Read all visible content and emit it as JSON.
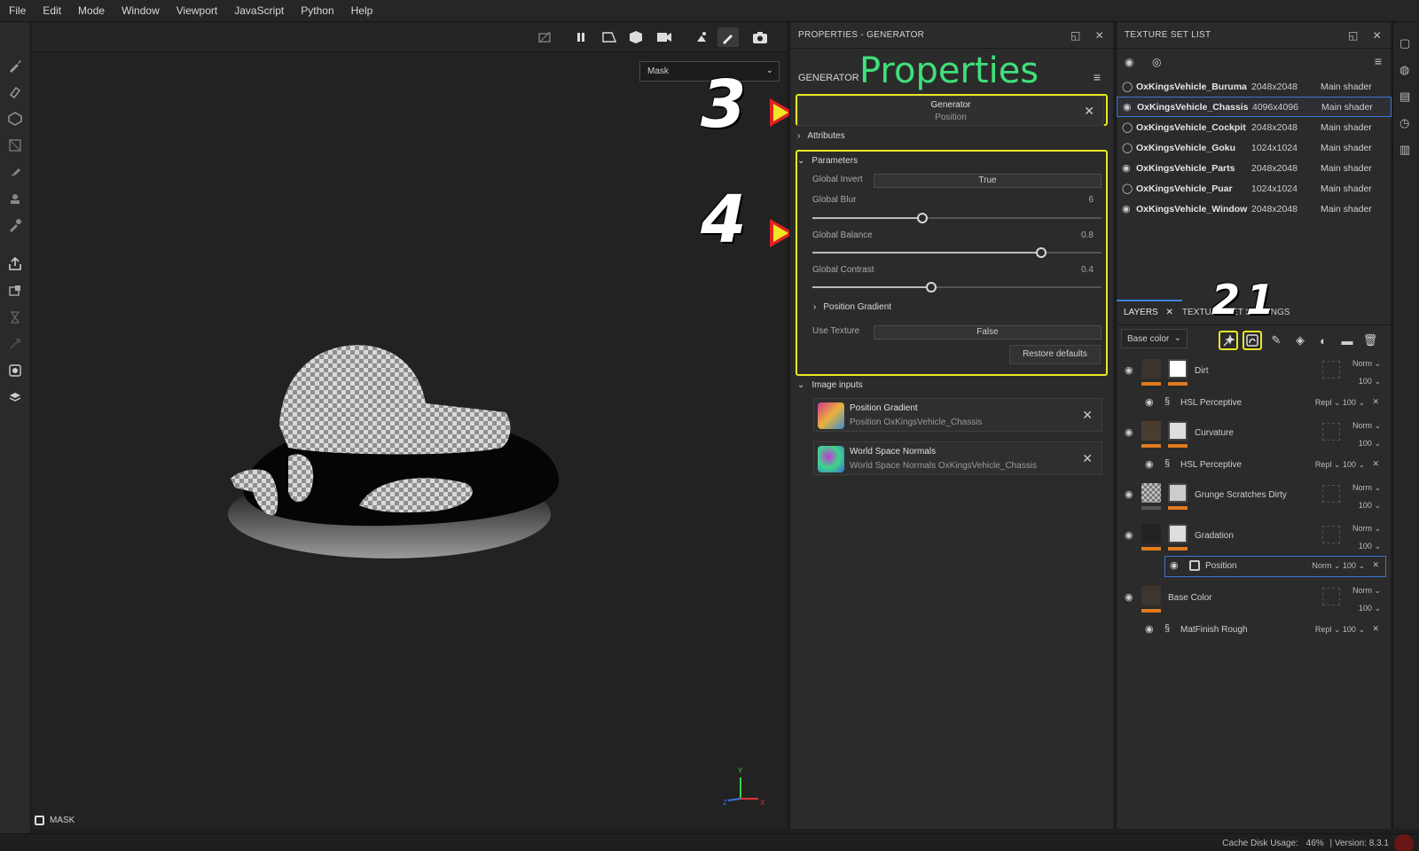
{
  "menu": [
    "File",
    "Edit",
    "Mode",
    "Window",
    "Viewport",
    "JavaScript",
    "Python",
    "Help"
  ],
  "viewport": {
    "mask_select": "Mask",
    "mask_label": "MASK",
    "axis_labels": {
      "y": "Y",
      "z": "Z",
      "x": "X"
    }
  },
  "properties": {
    "header": "PROPERTIES - GENERATOR",
    "section_title": "GENERATOR",
    "overlay_title": "Properties",
    "generator_card": {
      "title": "Generator",
      "subtitle": "Position"
    },
    "attributes_label": "Attributes",
    "parameters_label": "Parameters",
    "params": {
      "global_invert_label": "Global Invert",
      "global_invert_value": "True",
      "global_blur_label": "Global Blur",
      "global_blur_value": "6",
      "global_balance_label": "Global Balance",
      "global_balance_value": "0.8",
      "global_contrast_label": "Global Contrast",
      "global_contrast_value": "0.4",
      "position_gradient_label": "Position Gradient",
      "use_texture_label": "Use Texture",
      "use_texture_value": "False"
    },
    "slider_fractions": {
      "blur": 0.38,
      "balance": 0.79,
      "contrast": 0.41
    },
    "restore_label": "Restore defaults",
    "image_inputs_label": "Image inputs",
    "image_inputs": [
      {
        "name": "Position Gradient",
        "source": "Position OxKingsVehicle_Chassis"
      },
      {
        "name": "World Space Normals",
        "source": "World Space Normals OxKingsVehicle_Chassis"
      }
    ]
  },
  "annotations": {
    "num3": "3",
    "num4": "4",
    "num2": "2",
    "num1": "1"
  },
  "texture_set_list": {
    "header": "TEXTURE SET LIST",
    "rows": [
      {
        "name": "OxKingsVehicle_Buruma",
        "res": "2048x2048",
        "shader": "Main shader"
      },
      {
        "name": "OxKingsVehicle_Chassis",
        "res": "4096x4096",
        "shader": "Main shader"
      },
      {
        "name": "OxKingsVehicle_Cockpit",
        "res": "2048x2048",
        "shader": "Main shader"
      },
      {
        "name": "OxKingsVehicle_Goku",
        "res": "1024x1024",
        "shader": "Main shader"
      },
      {
        "name": "OxKingsVehicle_Parts",
        "res": "2048x2048",
        "shader": "Main shader"
      },
      {
        "name": "OxKingsVehicle_Puar",
        "res": "1024x1024",
        "shader": "Main shader"
      },
      {
        "name": "OxKingsVehicle_Window",
        "res": "2048x2048",
        "shader": "Main shader"
      }
    ]
  },
  "layers": {
    "tab_layers": "LAYERS",
    "tab_tss": "TEXTURE SET SETTINGS",
    "channel": "Base color",
    "items": [
      {
        "name": "Dirt",
        "blend": "Norm",
        "opacity": "100"
      },
      {
        "name": "HSL Perceptive",
        "blend": "Repl",
        "opacity": "100"
      },
      {
        "name": "Curvature",
        "blend": "Norm",
        "opacity": "100"
      },
      {
        "name": "HSL Perceptive",
        "blend": "Repl",
        "opacity": "100"
      },
      {
        "name": "Grunge Scratches Dirty",
        "blend": "Norm",
        "opacity": "100"
      },
      {
        "name": "Gradation",
        "blend": "Norm",
        "opacity": "100"
      },
      {
        "name": "Position",
        "blend": "Norm",
        "opacity": "100"
      },
      {
        "name": "Base Color",
        "blend": "Norm",
        "opacity": "100"
      },
      {
        "name": "MatFinish Rough",
        "blend": "Repl",
        "opacity": "100"
      }
    ]
  },
  "status": {
    "cache": "Cache Disk Usage:",
    "pct": "46%",
    "version": "| Version: 8.3.1"
  }
}
